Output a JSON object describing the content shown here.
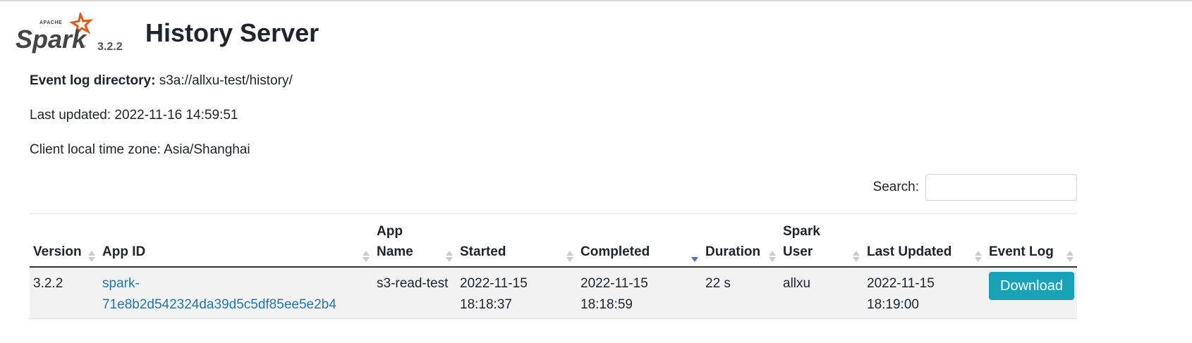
{
  "header": {
    "logo_text": "Spark",
    "logo_apache": "APACHE",
    "version": "3.2.2",
    "title": "History Server"
  },
  "info": {
    "event_log_label": "Event log directory:",
    "event_log_value": "s3a://allxu-test/history/",
    "last_updated": "Last updated: 2022-11-16 14:59:51",
    "timezone": "Client local time zone: Asia/Shanghai"
  },
  "search": {
    "label": "Search:",
    "value": ""
  },
  "table": {
    "headers": {
      "version": "Version",
      "app_id": "App ID",
      "app_name_1": "App",
      "app_name_2": "Name",
      "started": "Started",
      "completed": "Completed",
      "duration": "Duration",
      "spark_user_1": "Spark",
      "spark_user_2": "User",
      "last_updated": "Last Updated",
      "event_log": "Event Log"
    },
    "rows": [
      {
        "version": "3.2.2",
        "app_id_1": "spark-",
        "app_id_2": "71e8b2d542324da39d5c5df85ee5e2b4",
        "app_name": "s3-read-test",
        "started_1": "2022-11-15",
        "started_2": "18:18:37",
        "completed_1": "2022-11-15",
        "completed_2": "18:18:59",
        "duration": "22 s",
        "spark_user": "allxu",
        "last_updated_1": "2022-11-15",
        "last_updated_2": "18:19:00",
        "event_log": "Download"
      }
    ]
  },
  "colors": {
    "link": "#2176ae",
    "download_button": "#17a2b8",
    "sort_active": "#5b6bd6",
    "logo_orange": "#e25a1c"
  }
}
